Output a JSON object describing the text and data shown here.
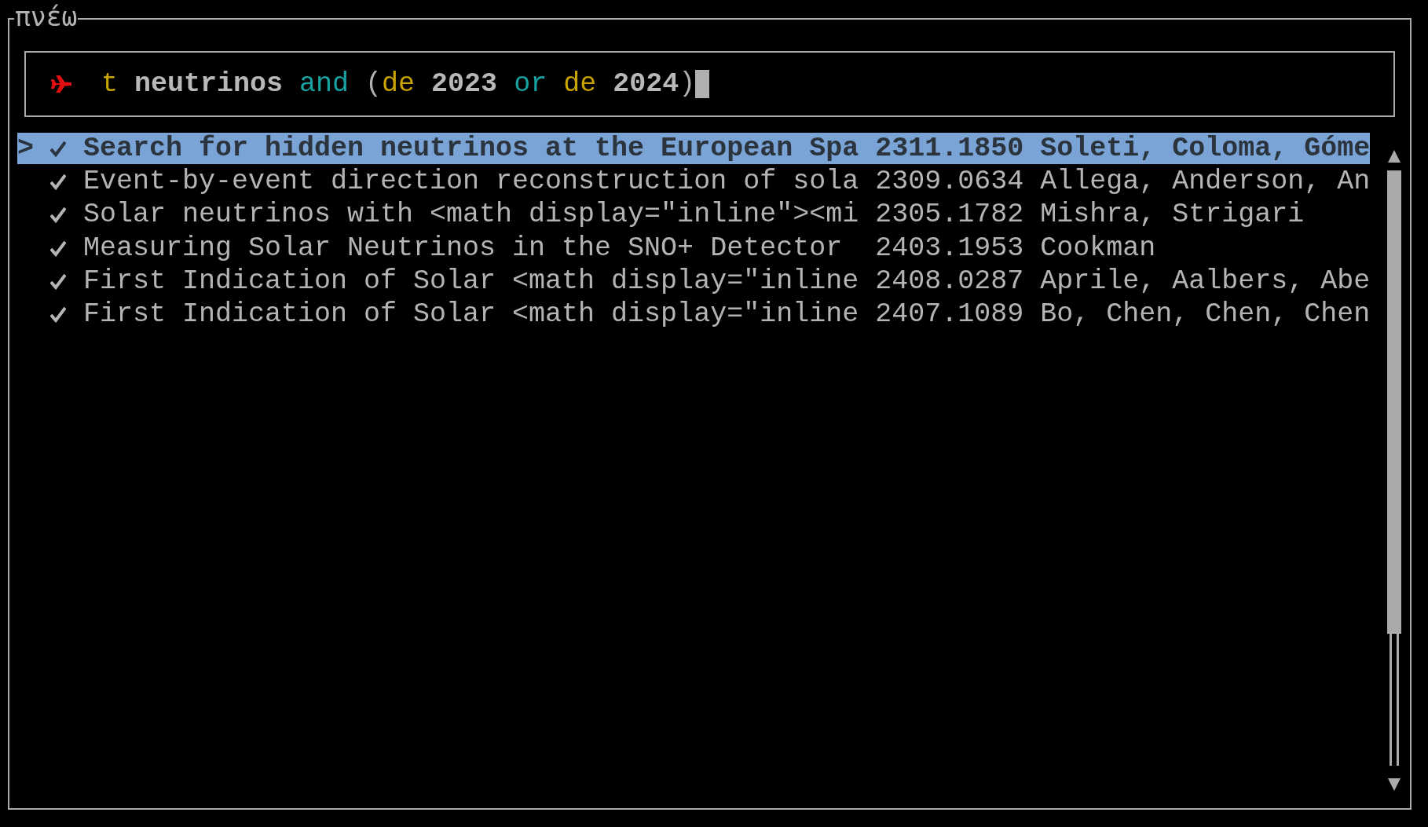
{
  "window": {
    "title": "πνέω"
  },
  "search": {
    "focused": true,
    "tokens": [
      {
        "text": "t",
        "kind": "field"
      },
      {
        "text": " neutrinos",
        "kind": "term"
      },
      {
        "text": " and",
        "kind": "operator"
      },
      {
        "text": " (",
        "kind": "paren"
      },
      {
        "text": "de",
        "kind": "field"
      },
      {
        "text": " 2023",
        "kind": "term"
      },
      {
        "text": " or",
        "kind": "operator"
      },
      {
        "text": " de",
        "kind": "field"
      },
      {
        "text": " 2024",
        "kind": "term"
      },
      {
        "text": ")",
        "kind": "paren"
      }
    ]
  },
  "results": {
    "pointer": ">",
    "rows": [
      {
        "selected": true,
        "checked": true,
        "title": "Search for hidden neutrinos at the European Spa",
        "id": "2311.1850",
        "authors": "Soleti, Coloma, Góme"
      },
      {
        "selected": false,
        "checked": true,
        "title": "Event-by-event direction reconstruction of sola",
        "id": "2309.0634",
        "authors": "Allega, Anderson, An"
      },
      {
        "selected": false,
        "checked": true,
        "title": "Solar neutrinos with <math display=\"inline\"><mi",
        "id": "2305.1782",
        "authors": "Mishra, Strigari"
      },
      {
        "selected": false,
        "checked": true,
        "title": "Measuring Solar Neutrinos in the SNO+ Detector",
        "id": "2403.1953",
        "authors": "Cookman"
      },
      {
        "selected": false,
        "checked": true,
        "title": "First Indication of Solar <math display=\"inline",
        "id": "2408.0287",
        "authors": "Aprile, Aalbers, Abe"
      },
      {
        "selected": false,
        "checked": true,
        "title": "First Indication of Solar <math display=\"inline",
        "id": "2407.1089",
        "authors": "Bo, Chen, Chen, Chen"
      }
    ]
  }
}
